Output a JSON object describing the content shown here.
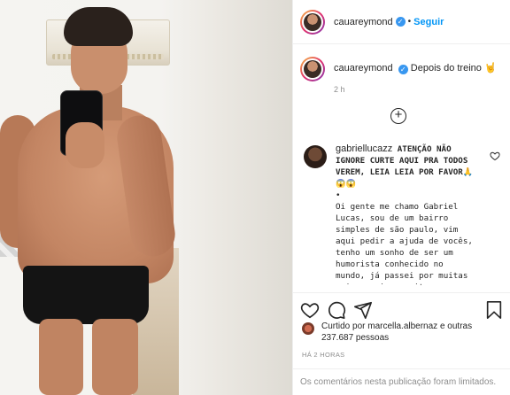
{
  "header": {
    "username": "cauareymond",
    "verified_icon": "verified-badge-icon",
    "separator": "•",
    "follow_label": "Seguir",
    "accent_color": "#0095f6"
  },
  "caption": {
    "username": "cauareymond",
    "text": "Depois do treino",
    "emoji": "🤘",
    "time_ago": "2 h"
  },
  "load_more_icon": "plus-circle-icon",
  "comment": {
    "username": "gabriellucazz",
    "bold_text": "ATENÇÃO NÃO IGNORE CURTE AQUI PRA TODOS VEREM, LEIA LEIA POR FAVOR🙏😱😱",
    "bullet": "•",
    "body": "Oi gente me chamo Gabriel Lucas, sou de um bairro simples de são paulo, vim aqui pedir a ajuda de vocês, tenho um sonho de ser um humorista conhecido no mundo, já passei por muitas coisas ruins, muitas"
  },
  "actions": {
    "like_icon": "heart-icon",
    "comment_icon": "comment-icon",
    "share_icon": "share-icon",
    "save_icon": "bookmark-icon"
  },
  "likes": {
    "text": "Curtido por marcella.albernaz e outras 237.687 pessoas"
  },
  "posted": "HÁ 2 HORAS",
  "footer": "Os comentários nesta publicação foram limitados."
}
